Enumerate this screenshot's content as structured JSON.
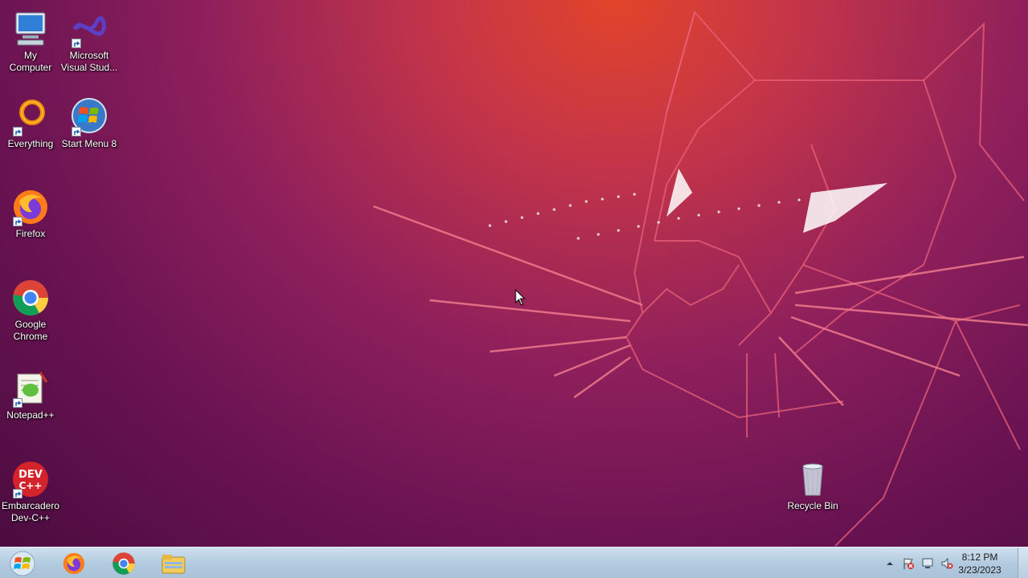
{
  "desktop": {
    "icons": [
      {
        "label": "My\nComputer",
        "icon": "computer-icon"
      },
      {
        "label": "Microsoft Visual Stud...",
        "icon": "visual-studio-icon"
      },
      {
        "label": "Everything",
        "icon": "everything-search-icon"
      },
      {
        "label": "Start Menu 8",
        "icon": "start-menu-orb-icon"
      },
      {
        "label": "Firefox",
        "icon": "firefox-icon"
      },
      {
        "label": "Google Chrome",
        "icon": "chrome-icon"
      },
      {
        "label": "Notepad++",
        "icon": "notepadpp-icon"
      },
      {
        "label": "Embarcadero Dev-C++",
        "icon": "devcpp-icon"
      },
      {
        "label": "Recycle Bin",
        "icon": "recycle-bin-icon"
      }
    ],
    "devcpp_logo_text": "DEV C++"
  },
  "taskbar": {
    "pinned": [
      {
        "name": "start-button",
        "icon": "windows-logo-icon"
      },
      {
        "name": "firefox",
        "icon": "firefox-icon"
      },
      {
        "name": "chrome",
        "icon": "chrome-icon"
      },
      {
        "name": "explorer",
        "icon": "folder-icon"
      }
    ],
    "tray": {
      "icons": [
        "show-hidden-icons-icon",
        "action-center-flag-icon",
        "network-icon",
        "volume-muted-icon"
      ]
    },
    "clock": {
      "time": "8:12 PM",
      "date": "3/23/2023"
    }
  },
  "colors": {
    "wallpaper_top": "#e2442a",
    "wallpaper_bottom": "#4b0c3f",
    "taskbar": "#b3cbe0"
  }
}
